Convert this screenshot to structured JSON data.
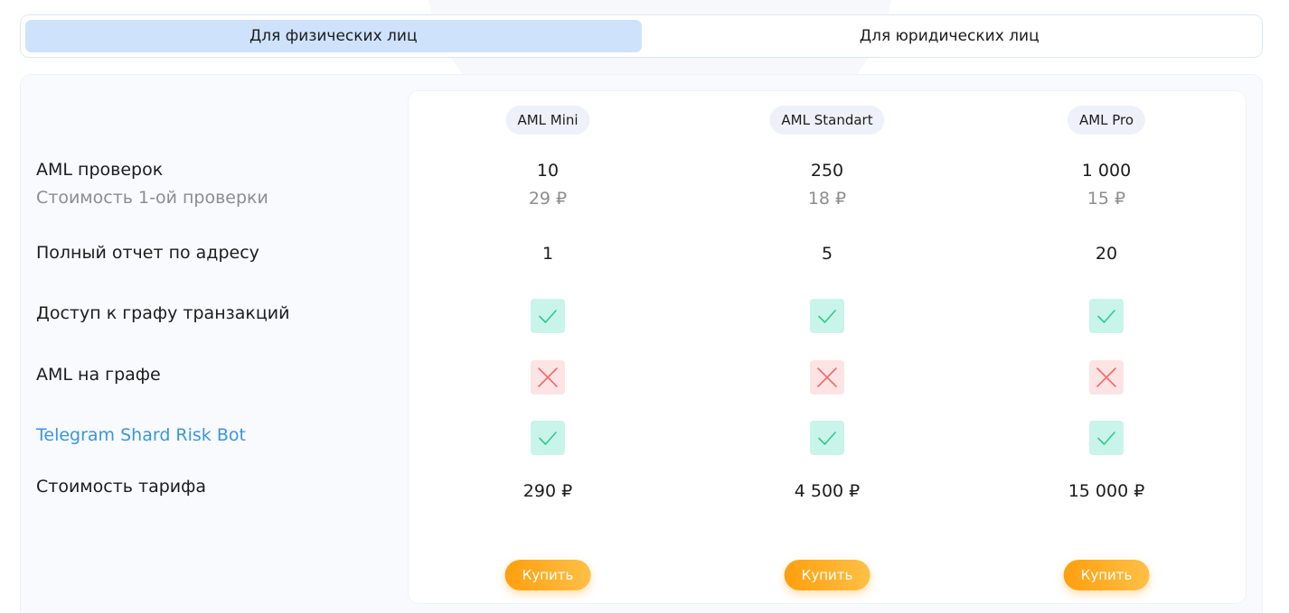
{
  "tabs": [
    {
      "label": "Для физических лиц",
      "active": true
    },
    {
      "label": "Для юридических лиц",
      "active": false
    }
  ],
  "features": {
    "aml_checks": "AML проверок",
    "check_cost": "Стоимость 1-ой проверки",
    "full_report": "Полный отчет по адресу",
    "graph_access": "Доступ к графу транзакций",
    "aml_graph": "AML на графе",
    "telegram_bot": "Telegram Shard Risk Bot",
    "plan_cost": "Стоимость тарифа"
  },
  "plans": [
    {
      "name": "AML Mini",
      "aml_checks": "10",
      "check_cost": "29 ₽",
      "full_report": "1",
      "graph_access": "check-icon",
      "aml_graph": "cross-icon",
      "telegram_bot": "check-icon",
      "price": "290 ₽",
      "buy_label": "Купить"
    },
    {
      "name": "AML Standart",
      "aml_checks": "250",
      "check_cost": "18 ₽",
      "full_report": "5",
      "graph_access": "check-icon",
      "aml_graph": "cross-icon",
      "telegram_bot": "check-icon",
      "price": "4 500 ₽",
      "buy_label": "Купить"
    },
    {
      "name": "AML Pro",
      "aml_checks": "1 000",
      "check_cost": "15 ₽",
      "full_report": "20",
      "graph_access": "check-icon",
      "aml_graph": "cross-icon",
      "telegram_bot": "check-icon",
      "price": "15 000 ₽",
      "buy_label": "Купить"
    }
  ],
  "colors": {
    "tab_active": "#cfe2fb",
    "check_bg": "#c9f4e9",
    "check_stroke": "#2fc98f",
    "cross_bg": "#fde4e4",
    "cross_stroke": "#f26a6a",
    "link": "#3b95de",
    "button_start": "#ff9f0e",
    "button_end": "#ffc046"
  }
}
